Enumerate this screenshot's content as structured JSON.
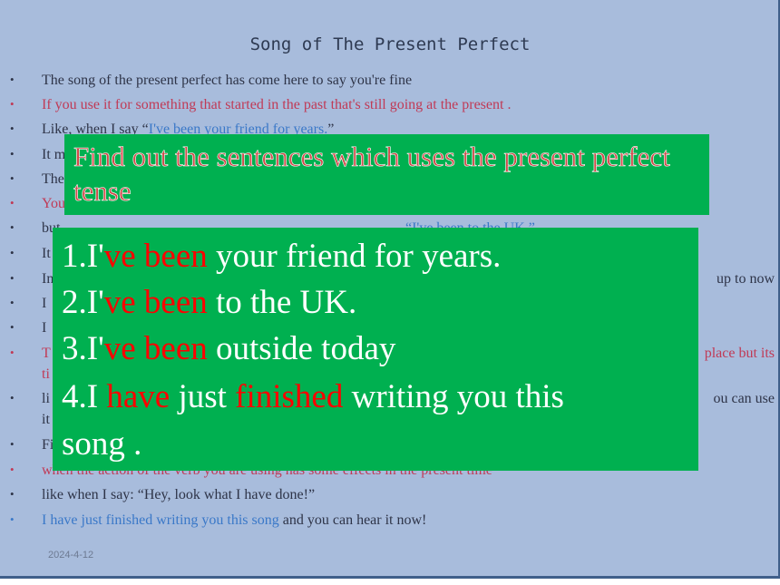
{
  "slide": {
    "title": "Song of The Present Perfect",
    "date": "2024-4-12",
    "lines": [
      {
        "color": "dark",
        "text": "The song of the present perfect has come here to say you're fine"
      },
      {
        "color": "red",
        "text": "If you use it for something that started in the past that's still going at the present ."
      },
      {
        "color": "dark",
        "text": "Like, when I say “",
        "quote": "I've been your friend for years.",
        "after": "”"
      },
      {
        "color": "dark",
        "text": "It m"
      },
      {
        "color": "dark",
        "text": "The"
      },
      {
        "color": "red",
        "text": "You"
      },
      {
        "color": "dark",
        "text": "but",
        "quote": "“I've been to the UK.”"
      },
      {
        "color": "dark",
        "text": "It"
      },
      {
        "color": "dark",
        "text": "In",
        "right": "up to now"
      },
      {
        "color": "dark",
        "text": "I"
      },
      {
        "color": "dark",
        "text": "I"
      },
      {
        "color": "red",
        "text": "T",
        "right": "place but its"
      },
      {
        "color": "red",
        "text": "ti"
      },
      {
        "color": "dark",
        "text": " li",
        "right": "ou can use"
      },
      {
        "color": "dark",
        "text": "it"
      },
      {
        "color": "dark",
        "text": "Fi"
      },
      {
        "color": "red",
        "text": "when the action of the verb you are using has some effects in the present time"
      },
      {
        "color": "dark",
        "text": "like when I say: “Hey, look what I have done!”"
      },
      {
        "color": "blue",
        "text": "I have just finished writing you this song",
        "after": " and you can hear it now!"
      }
    ]
  },
  "question": "Find out the sentences which uses the present perfect tense",
  "answers": [
    {
      "pre": "1.I'",
      "hl1": "ve been",
      "mid": " your friend for years."
    },
    {
      "pre": "2.I'",
      "hl1": "ve been",
      "mid": " to the UK."
    },
    {
      "pre": "3.I'",
      "hl1": "ve been",
      "mid": " outside today"
    },
    {
      "pre": "4.I ",
      "hl1": "have",
      "mid": " just ",
      "hl2": "finished",
      "post": " writing you this"
    },
    {
      "pre": "song ."
    }
  ],
  "colors": {
    "background": "#a8bcdc",
    "box": "#00b050",
    "highlight": "#ff0000",
    "red_text": "#c03a56",
    "blue_text": "#3a78c8"
  }
}
